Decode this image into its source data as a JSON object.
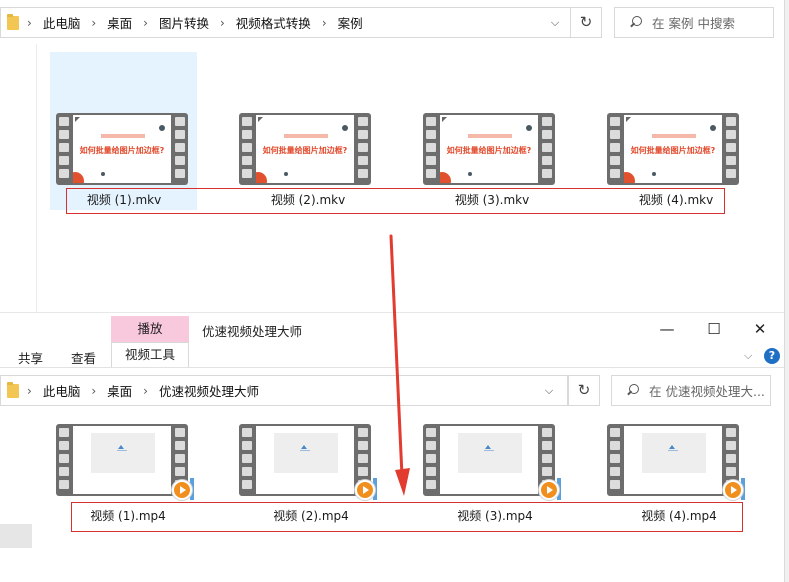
{
  "top_window": {
    "breadcrumb": [
      "此电脑",
      "桌面",
      "图片转换",
      "视频格式转换",
      "案例"
    ],
    "search_placeholder": "在 案例 中搜索",
    "slide_title": "如何批量给图片加边框?",
    "files": [
      "视频 (1).mkv",
      "视频 (2).mkv",
      "视频 (3).mkv",
      "视频 (4).mkv"
    ]
  },
  "bottom_window": {
    "title": "优速视频处理大师",
    "ribbon_tabs": {
      "share": "共享",
      "view": "查看",
      "play": "播放",
      "video_tools": "视频工具"
    },
    "window_controls": {
      "minimize": "—",
      "maximize": "☐",
      "close": "✕"
    },
    "help": "?",
    "breadcrumb": [
      "此电脑",
      "桌面",
      "优速视频处理大师"
    ],
    "search_placeholder": "在 优速视频处理大...",
    "files": [
      "视频 (1).mp4",
      "视频 (2).mp4",
      "视频 (3).mp4",
      "视频 (4).mp4"
    ]
  },
  "icons": {
    "separator": "›",
    "dropdown": "⌵",
    "refresh": "↻"
  },
  "colors": {
    "selection": "#e5f3ff",
    "highlight_box": "#d63030",
    "play_tab": "#f8c8dc",
    "accent_orange": "#f08f1d"
  }
}
